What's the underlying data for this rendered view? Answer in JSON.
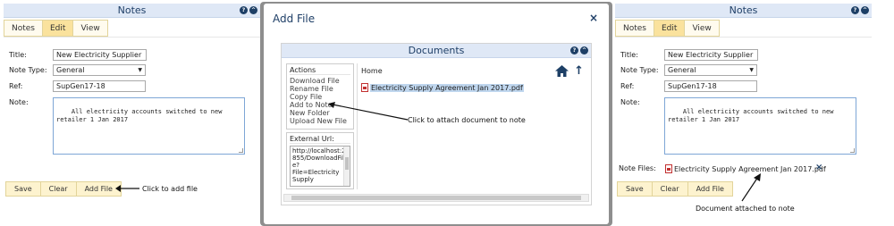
{
  "left_panel": {
    "title": "Notes",
    "tabs": [
      "Notes",
      "Edit",
      "View"
    ],
    "fields": {
      "title_label": "Title:",
      "title_value": "New Electricity Supplier",
      "note_type_label": "Note Type:",
      "note_type_value": "General",
      "ref_label": "Ref:",
      "ref_value": "SupGen17-18",
      "note_label": "Note:",
      "note_value": "All electricity accounts switched to new\nretailer 1 Jan 2017"
    },
    "buttons": [
      "Save",
      "Clear",
      "Add File"
    ],
    "annotation": "Click to add file"
  },
  "modal": {
    "title": "Add File",
    "close_glyph": "×",
    "documents_title": "Documents",
    "actions_header": "Actions",
    "actions": [
      "Download File",
      "Rename File",
      "Copy File",
      "Add to Note",
      "New Folder",
      "Upload New File"
    ],
    "external_url_header": "External Url:",
    "external_url_value": "http://localhost:2\n855/DownloadFil\ne?\nFile=Electricity\nSupply",
    "breadcrumb": "Home",
    "file_name": "Electricity Supply Agreement Jan 2017.pdf",
    "annotation": "Click to attach document to note"
  },
  "right_panel": {
    "title": "Notes",
    "tabs": [
      "Notes",
      "Edit",
      "View"
    ],
    "fields": {
      "title_label": "Title:",
      "title_value": "New Electricity Supplier",
      "note_type_label": "Note Type:",
      "note_type_value": "General",
      "ref_label": "Ref:",
      "ref_value": "SupGen17-18",
      "note_label": "Note:",
      "note_value": "All electricity accounts switched to new\nretailer 1 Jan 2017"
    },
    "note_files_label": "Note Files:",
    "attached_file": "Electricity Supply Agreement Jan 2017.pdf",
    "remove_glyph": "×",
    "buttons": [
      "Save",
      "Clear",
      "Add File"
    ],
    "annotation": "Document attached to note"
  },
  "icons": {
    "help": "?",
    "collapse": "^"
  },
  "colors": {
    "titlebar_bg": "#dfe8f6",
    "title_text": "#1f3f67",
    "tab_bg": "#fdf3cf",
    "tab_active_bg": "#fae29d",
    "accent_dark": "#1d3f66"
  }
}
